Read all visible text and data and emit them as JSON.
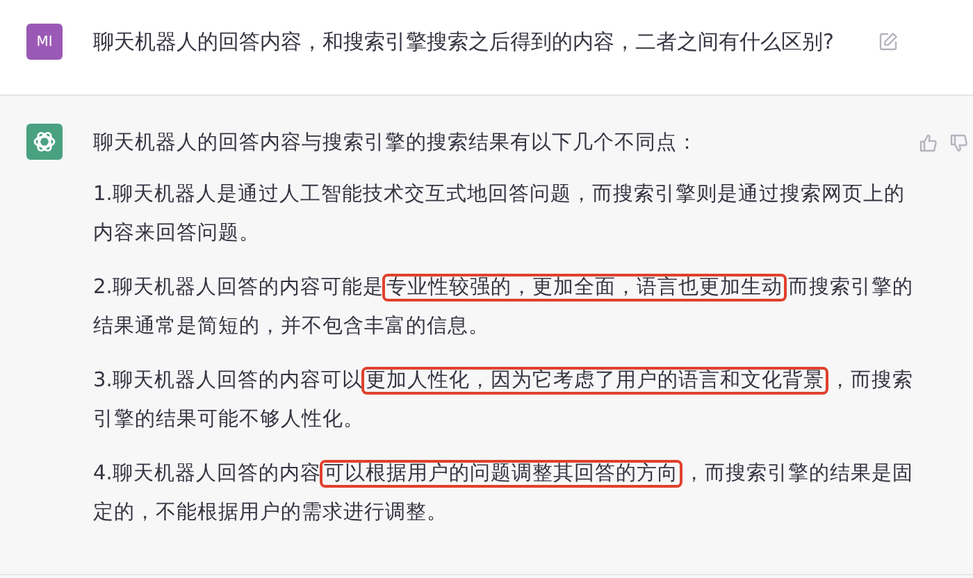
{
  "question": {
    "avatar": "MI",
    "text": "聊天机器人的回答内容，和搜索引擎搜索之后得到的内容，二者之间有什么区别?"
  },
  "answer": {
    "intro": "聊天机器人的回答内容与搜索引擎的搜索结果有以下几个不同点：",
    "paragraphs": [
      {
        "segments": [
          {
            "text": "1.聊天机器人是通过人工智能技术交互式地回答问题，而搜索引擎则是通过搜索网页上的内容来回答问题。",
            "highlighted": false
          }
        ]
      },
      {
        "segments": [
          {
            "text": "2.聊天机器人回答的内容可能是",
            "highlighted": false
          },
          {
            "text": "专业性较强的，更加全面，语言也更加生动",
            "highlighted": true
          },
          {
            "text": "而搜索引擎的结果通常是简短的，并不包含丰富的信息。",
            "highlighted": false
          }
        ]
      },
      {
        "segments": [
          {
            "text": "3.聊天机器人回答的内容可以",
            "highlighted": false
          },
          {
            "text": "更加人性化，因为它考虑了用户的语言和文化背景",
            "highlighted": true
          },
          {
            "text": "，而搜索引擎的结果可能不够人性化。",
            "highlighted": false
          }
        ]
      },
      {
        "segments": [
          {
            "text": "4.聊天机器人回答的内容",
            "highlighted": false
          },
          {
            "text": "可以根据用户的问题调整其回答的方向",
            "highlighted": true
          },
          {
            "text": "，而搜索引擎的结果是固定的，不能根据用户的需求进行调整。",
            "highlighted": false
          }
        ]
      }
    ]
  }
}
